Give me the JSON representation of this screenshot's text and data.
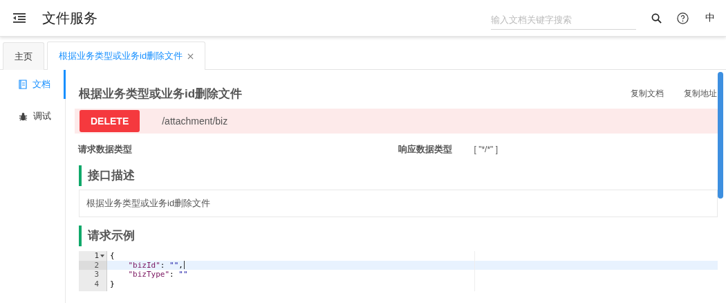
{
  "header": {
    "title": "文件服务",
    "search": {
      "placeholder": "输入文档关键字搜索"
    },
    "language": "中"
  },
  "tabs": [
    {
      "label": "主页",
      "selected": false,
      "closable": false
    },
    {
      "label": "根据业务类型或业务id删除文件",
      "selected": true,
      "closable": true
    }
  ],
  "side_menu": [
    {
      "label": "文档",
      "kind": "document",
      "selected": true
    },
    {
      "label": "调试",
      "kind": "debug",
      "selected": false
    }
  ],
  "doc": {
    "title": "根据业务类型或业务id删除文件",
    "actions": [
      "复制文档",
      "复制地址"
    ],
    "method": "DELETE",
    "path": "/attachment/biz",
    "request_type_label": "请求数据类型",
    "response_type_label": "响应数据类型",
    "response_type": "[ \"*/*\" ]",
    "sections": [
      {
        "heading": "接口描述",
        "text": "根据业务类型或业务id删除文件"
      },
      {
        "heading": "请求示例"
      }
    ],
    "code": {
      "lines": [
        {
          "number": "1",
          "kind": "brace",
          "fold": true,
          "active": false,
          "tokens": [
            {
              "kind": "punct",
              "text": "{"
            }
          ]
        },
        {
          "number": "2",
          "kind": "member",
          "fold": false,
          "active": true,
          "tokens": [
            {
              "kind": "key",
              "text": "\"bizId\""
            },
            {
              "kind": "punct",
              "text": ": "
            },
            {
              "kind": "string",
              "text": "\"\""
            },
            {
              "kind": "punct",
              "text": ","
            }
          ]
        },
        {
          "number": "3",
          "kind": "member",
          "fold": false,
          "active": false,
          "tokens": [
            {
              "kind": "key",
              "text": "\"bizType\""
            },
            {
              "kind": "punct",
              "text": ": "
            },
            {
              "kind": "string",
              "text": "\"\""
            }
          ]
        },
        {
          "number": "4",
          "kind": "brace",
          "fold": false,
          "active": false,
          "tokens": [
            {
              "kind": "punct",
              "text": "}"
            }
          ]
        }
      ]
    }
  }
}
